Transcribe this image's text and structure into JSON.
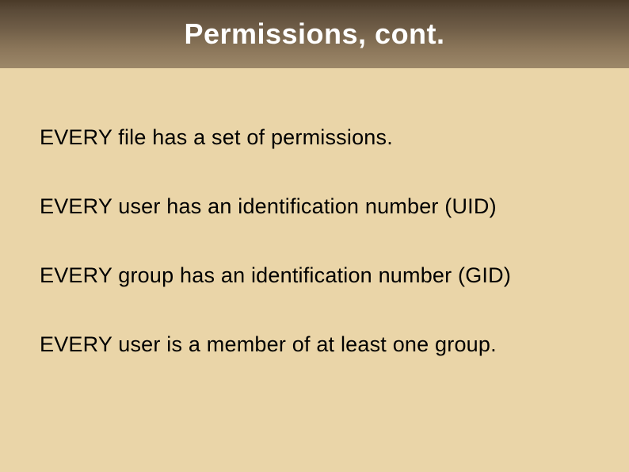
{
  "slide": {
    "title": "Permissions, cont.",
    "lines": [
      "EVERY file has a set of permissions.",
      "EVERY user has an identification number (UID)",
      "EVERY group has an identification number (GID)",
      "EVERY user is a member of at least one group."
    ]
  }
}
